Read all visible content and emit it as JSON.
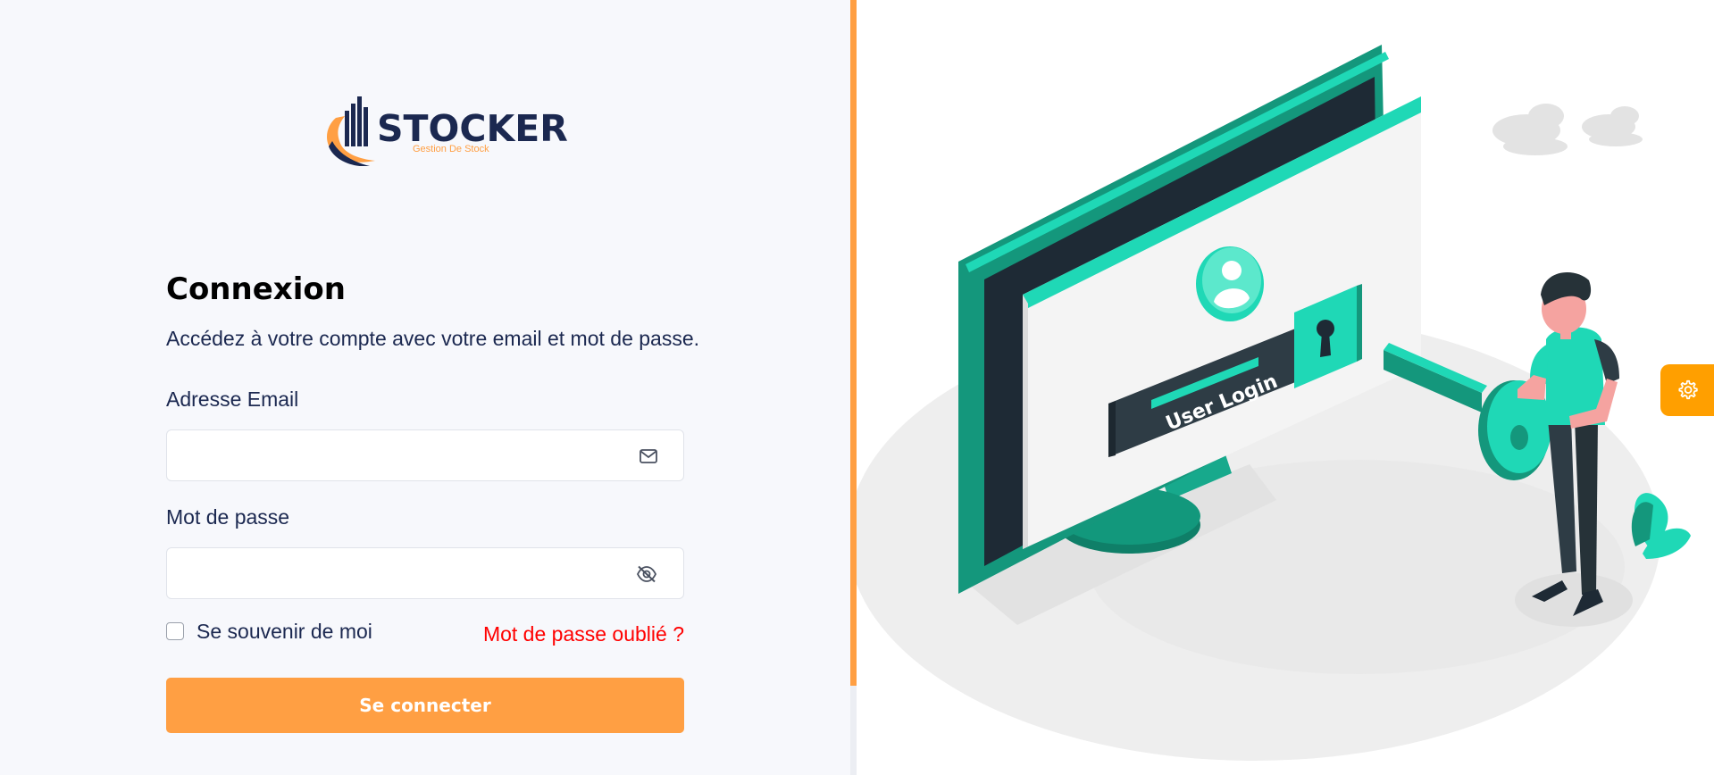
{
  "brand": {
    "name": "STOCKER",
    "tagline": "Gestion De Stock"
  },
  "login": {
    "title": "Connexion",
    "subtitle": "Accédez à votre compte avec votre email et mot de passe.",
    "email_label": "Adresse Email",
    "email_value": "",
    "email_icon": "mail-icon",
    "password_label": "Mot de passe",
    "password_value": "",
    "password_icon": "eye-slash-icon",
    "remember_label": "Se souvenir de moi",
    "remember_checked": false,
    "forgot_label": "Mot de passe oublié ?",
    "submit_label": "Se connecter"
  },
  "illustration": {
    "screen_label": "User Login"
  },
  "settings": {
    "icon": "gear-icon"
  },
  "colors": {
    "accent": "#ff9f43",
    "link": "#ff0000",
    "teal": "#1fd8b6",
    "dark": "#1b2850"
  }
}
